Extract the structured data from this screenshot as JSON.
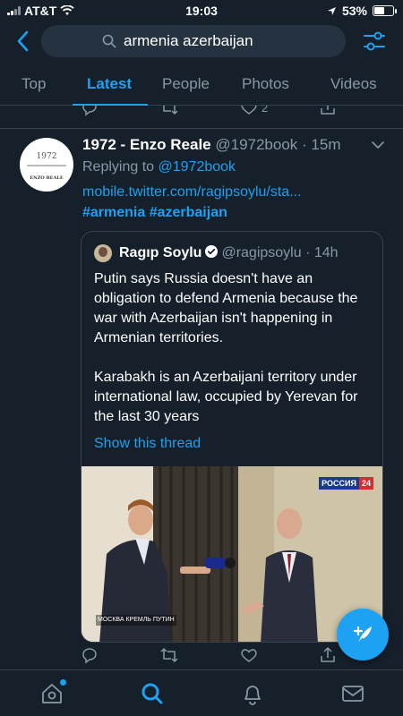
{
  "status_bar": {
    "carrier": "AT&T",
    "time": "19:03",
    "battery_percent": "53%",
    "battery_level": 0.53
  },
  "search": {
    "query": "armenia azerbaijan"
  },
  "tabs": [
    {
      "label": "Top"
    },
    {
      "label": "Latest"
    },
    {
      "label": "People"
    },
    {
      "label": "Photos"
    },
    {
      "label": "Videos"
    }
  ],
  "active_tab": "Latest",
  "prev_tweet": {
    "like_count": "2"
  },
  "tweet": {
    "name": "1972 - Enzo Reale",
    "handle": "@1972book",
    "time": "15m",
    "replying_prefix": "Replying to",
    "replying_to": "@1972book",
    "link": "mobile.twitter.com/ragipsoylu/sta...",
    "hashtags": "#armenia #azerbaijan",
    "avatar_text": {
      "number": "1972",
      "name": "ENZO REALE"
    }
  },
  "quote": {
    "name": "Ragıp Soylu",
    "handle": "@ragipsoylu",
    "time": "14h",
    "paragraph1": "Putin says Russia doesn't have an obligation to defend Armenia because the war with Azerbaijan isn't happening in Armenian territories.",
    "paragraph2": "Karabakh is an Azerbaijani territory under international law, occupied by Yerevan for the last 30 years",
    "show_thread": "Show this thread",
    "media_badge_1": "РОССИЯ",
    "media_badge_2": "24",
    "media_caption": "МОСКВА КРЕМЛЬ ПУТИН"
  },
  "icons": {
    "back": "chevron-left-icon",
    "search": "search-icon",
    "filter": "sliders-icon",
    "reply": "reply-icon",
    "retweet": "retweet-icon",
    "like": "heart-icon",
    "share": "share-icon",
    "compose": "compose-icon",
    "home": "home-icon",
    "explore": "search-icon",
    "notifications": "bell-icon",
    "messages": "mail-icon"
  },
  "colors": {
    "background": "#15202b",
    "accent": "#1da1f2",
    "muted": "#8899a6",
    "border": "#38444d"
  }
}
